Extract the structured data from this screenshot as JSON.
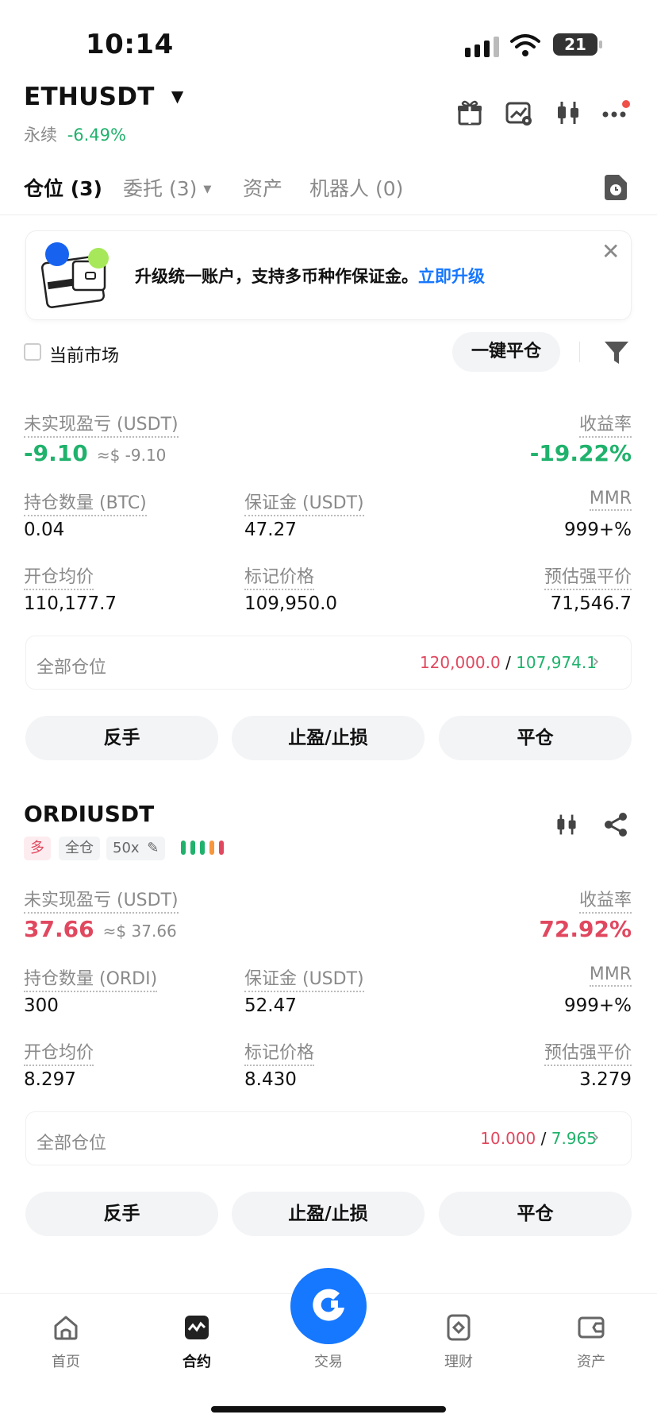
{
  "status_bar": {
    "time": "10:14",
    "battery": "21"
  },
  "header": {
    "pair": "ETHUSDT",
    "type": "永续",
    "change": "-6.49%"
  },
  "tabs": [
    {
      "label": "仓位 (3)",
      "active": true
    },
    {
      "label": "委托 (3)",
      "active": false
    },
    {
      "label": "资产",
      "active": false
    },
    {
      "label": "机器人 (0)",
      "active": false
    }
  ],
  "banner": {
    "text": "升级统一账户，支持多币种作保证金。",
    "link": "立即升级"
  },
  "filter": {
    "current_market": "当前市场",
    "close_all": "一键平仓"
  },
  "position1": {
    "pnl_label": "未实现盈亏 (USDT)",
    "pnl": "-9.10",
    "pnl_usd": "≈$ -9.10",
    "roe_label": "收益率",
    "roe": "-19.22%",
    "size_label": "持仓数量 (BTC)",
    "size": "0.04",
    "margin_label": "保证金 (USDT)",
    "margin": "47.27",
    "mmr_label": "MMR",
    "mmr": "999+%",
    "entry_label": "开仓均价",
    "entry": "110,177.7",
    "mark_label": "标记价格",
    "mark": "109,950.0",
    "liq_label": "预估强平价",
    "liq": "71,546.7",
    "all_label": "全部仓位",
    "all_red": "120,000.0",
    "all_sep": "/",
    "all_green": "107,974.1",
    "btn_reverse": "反手",
    "btn_tpsl": "止盈/止损",
    "btn_close": "平仓"
  },
  "position2": {
    "symbol": "ORDIUSDT",
    "tag_side": "多",
    "tag_mode": "全仓",
    "tag_lev": "50x",
    "pnl_label": "未实现盈亏 (USDT)",
    "pnl": "37.66",
    "pnl_usd": "≈$ 37.66",
    "roe_label": "收益率",
    "roe": "72.92%",
    "size_label": "持仓数量 (ORDI)",
    "size": "300",
    "margin_label": "保证金 (USDT)",
    "margin": "52.47",
    "mmr_label": "MMR",
    "mmr": "999+%",
    "entry_label": "开仓均价",
    "entry": "8.297",
    "mark_label": "标记价格",
    "mark": "8.430",
    "liq_label": "预估强平价",
    "liq": "3.279",
    "all_label": "全部仓位",
    "all_red": "10.000",
    "all_sep": "/",
    "all_green": "7.965",
    "btn_reverse": "反手",
    "btn_tpsl": "止盈/止损",
    "btn_close": "平仓"
  },
  "bottom_nav": [
    {
      "label": "首页",
      "icon": "home-icon"
    },
    {
      "label": "合约",
      "icon": "futures-icon"
    },
    {
      "label": "交易",
      "icon": "trade-icon"
    },
    {
      "label": "理财",
      "icon": "earn-icon"
    },
    {
      "label": "资产",
      "icon": "wallet-icon"
    }
  ],
  "colors": {
    "green": "#20b26c",
    "red": "#e0485f",
    "orange": "#f7963c",
    "blue": "#1677ff"
  }
}
